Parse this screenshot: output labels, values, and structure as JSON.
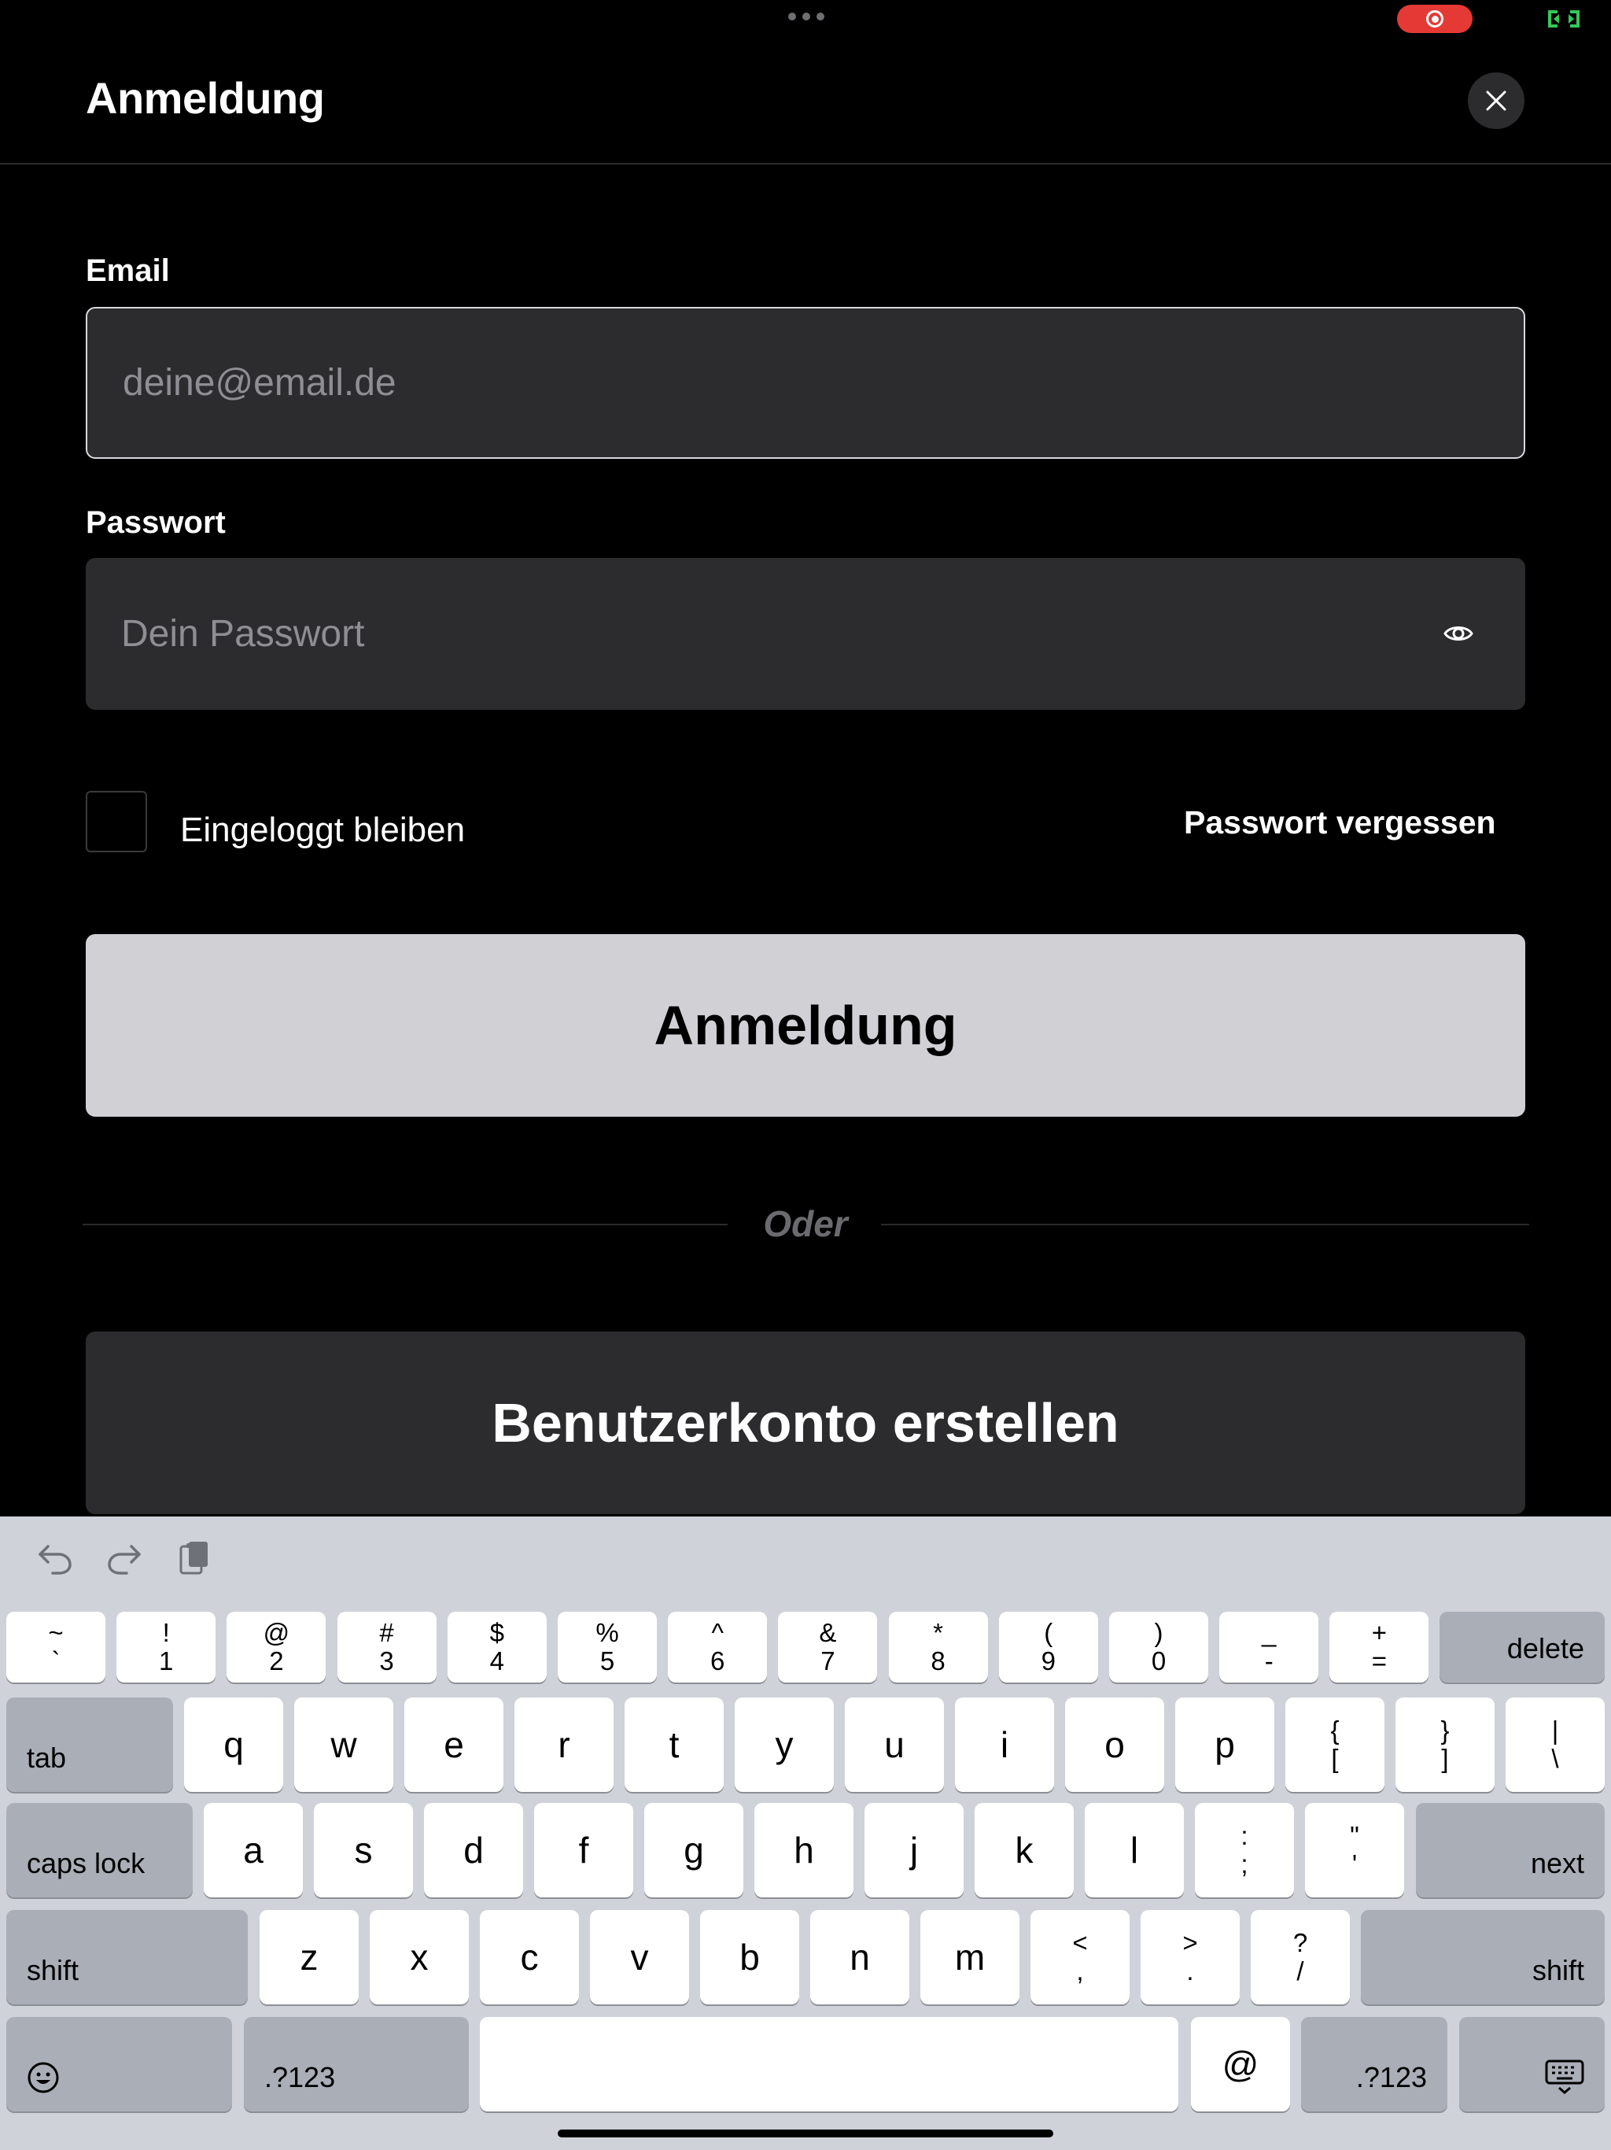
{
  "header": {
    "title": "Anmeldung"
  },
  "form": {
    "email_label": "Email",
    "email_placeholder": "deine@email.de",
    "password_label": "Passwort",
    "password_placeholder": "Dein Passwort",
    "remember_label": "Eingeloggt bleiben",
    "remember_checked": false,
    "forgot_link": "Passwort vergessen",
    "login_button": "Anmeldung",
    "or_divider": "Oder",
    "signup_button": "Benutzerkonto erstellen"
  },
  "colors": {
    "background": "#000000",
    "input_bg": "#2c2c2e",
    "primary_button": "#d1d0d5",
    "record_indicator": "#e53935",
    "status_green": "#34c759"
  },
  "keyboard": {
    "row1": [
      {
        "top": "~",
        "bottom": "`"
      },
      {
        "top": "!",
        "bottom": "1"
      },
      {
        "top": "@",
        "bottom": "2"
      },
      {
        "top": "#",
        "bottom": "3"
      },
      {
        "top": "$",
        "bottom": "4"
      },
      {
        "top": "%",
        "bottom": "5"
      },
      {
        "top": "^",
        "bottom": "6"
      },
      {
        "top": "&",
        "bottom": "7"
      },
      {
        "top": "*",
        "bottom": "8"
      },
      {
        "top": "(",
        "bottom": "9"
      },
      {
        "top": ")",
        "bottom": "0"
      },
      {
        "top": "_",
        "bottom": "-"
      },
      {
        "top": "+",
        "bottom": "="
      }
    ],
    "delete": "delete",
    "tab": "tab",
    "row2": [
      "q",
      "w",
      "e",
      "r",
      "t",
      "y",
      "u",
      "i",
      "o",
      "p"
    ],
    "row2_extra": [
      {
        "top": "{",
        "bottom": "["
      },
      {
        "top": "}",
        "bottom": "]"
      },
      {
        "top": "|",
        "bottom": "\\"
      }
    ],
    "caps_lock": "caps lock",
    "row3": [
      "a",
      "s",
      "d",
      "f",
      "g",
      "h",
      "j",
      "k",
      "l"
    ],
    "row3_extra": [
      {
        "top": ":",
        "bottom": ";"
      },
      {
        "top": "\"",
        "bottom": "'"
      }
    ],
    "next": "next",
    "shift": "shift",
    "row4": [
      "z",
      "x",
      "c",
      "v",
      "b",
      "n",
      "m"
    ],
    "row4_extra": [
      {
        "top": "<",
        "bottom": ","
      },
      {
        "top": ">",
        "bottom": "."
      },
      {
        "top": "?",
        "bottom": "/"
      }
    ],
    "numbers_key": ".?123",
    "at_key": "@"
  }
}
